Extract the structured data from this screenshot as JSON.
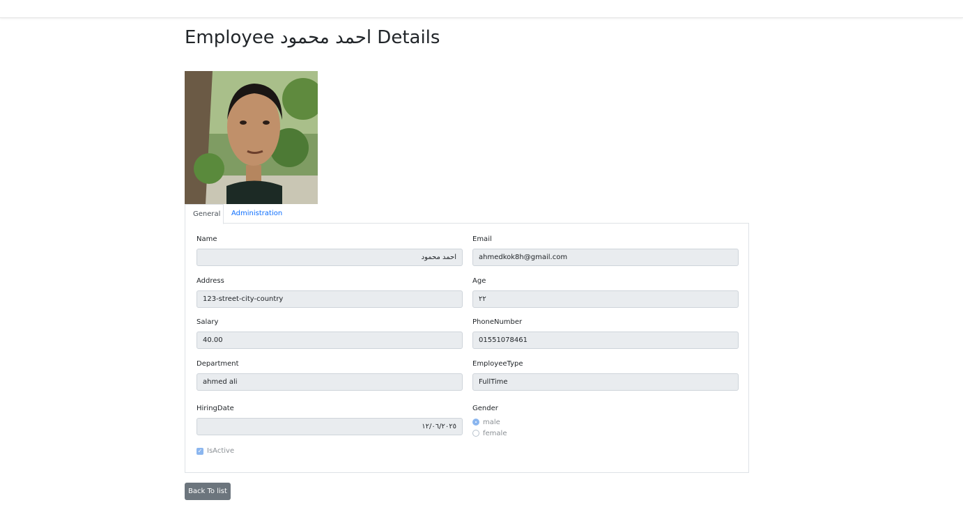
{
  "page": {
    "title": "Employee احمد محمود Details"
  },
  "tabs": [
    {
      "label": "General"
    },
    {
      "label": "Administration"
    }
  ],
  "form": {
    "name": {
      "label": "Name",
      "value": "احمد محمود"
    },
    "email": {
      "label": "Email",
      "value": "ahmedkok8h@gmail.com"
    },
    "address": {
      "label": "Address",
      "value": "123-street-city-country"
    },
    "age": {
      "label": "Age",
      "value": "٢٢"
    },
    "salary": {
      "label": "Salary",
      "value": "40.00"
    },
    "phone": {
      "label": "PhoneNumber",
      "value": "01551078461"
    },
    "department": {
      "label": "Department",
      "value": "ahmed ali"
    },
    "employee_type": {
      "label": "EmployeeType",
      "value": "FullTime"
    },
    "hiring_date": {
      "label": "HiringDate",
      "value": "١٢/٠٦/٢٠٢٥"
    },
    "gender": {
      "label": "Gender",
      "options": [
        {
          "label": "male",
          "checked": true
        },
        {
          "label": "female",
          "checked": false
        }
      ]
    },
    "is_active": {
      "label": "IsActive",
      "checked": true
    }
  },
  "actions": {
    "back_label": "Back To list"
  },
  "colors": {
    "link": "#0d6efd",
    "button": "#6c757d",
    "readonly_bg": "#e9ecef"
  }
}
